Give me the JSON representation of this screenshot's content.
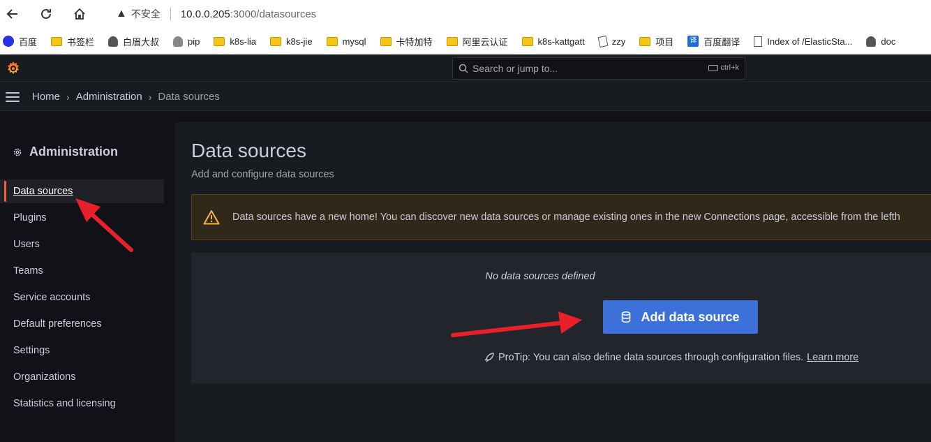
{
  "browser": {
    "insecure_label": "不安全",
    "url_host": "10.0.0.205",
    "url_path": ":3000/datasources",
    "bookmarks": [
      {
        "label": "百度",
        "icon": "baidu-icon"
      },
      {
        "label": "书签栏",
        "icon": "folder-icon"
      },
      {
        "label": "白眉大叔",
        "icon": "person-icon"
      },
      {
        "label": "pip",
        "icon": "person-icon"
      },
      {
        "label": "k8s-lia",
        "icon": "folder-icon"
      },
      {
        "label": "k8s-jie",
        "icon": "folder-icon"
      },
      {
        "label": "mysql",
        "icon": "folder-icon"
      },
      {
        "label": "卡特加特",
        "icon": "folder-icon"
      },
      {
        "label": "阿里云认证",
        "icon": "folder-icon"
      },
      {
        "label": "k8s-kattgatt",
        "icon": "folder-icon"
      },
      {
        "label": "zzy",
        "icon": "note-icon"
      },
      {
        "label": "项目",
        "icon": "folder-icon"
      },
      {
        "label": "百度翻译",
        "icon": "translate-icon"
      },
      {
        "label": "Index of /ElasticSta...",
        "icon": "document-icon"
      },
      {
        "label": "doc",
        "icon": "person-icon"
      }
    ]
  },
  "topbar": {
    "search_placeholder": "Search or jump to...",
    "shortcut": "ctrl+k"
  },
  "breadcrumb": {
    "home": "Home",
    "admin": "Administration",
    "current": "Data sources"
  },
  "sidebar": {
    "title": "Administration",
    "items": [
      {
        "label": "Data sources",
        "active": true
      },
      {
        "label": "Plugins"
      },
      {
        "label": "Users"
      },
      {
        "label": "Teams"
      },
      {
        "label": "Service accounts"
      },
      {
        "label": "Default preferences"
      },
      {
        "label": "Settings"
      },
      {
        "label": "Organizations"
      },
      {
        "label": "Statistics and licensing"
      }
    ]
  },
  "main": {
    "title": "Data sources",
    "subtitle": "Add and configure data sources",
    "alert_text": "Data sources have a new home! You can discover new data sources or manage existing ones in the new Connections page, accessible from the lefth",
    "empty_text": "No data sources defined",
    "add_button": "Add data source",
    "protip": "ProTip: You can also define data sources through configuration files.",
    "learn_more": "Learn more"
  },
  "colors": {
    "primary": "#3d71d9",
    "active_indicator": "#f55f3e",
    "warning": "#f5b73d",
    "annotation_arrow": "#e8202a"
  }
}
